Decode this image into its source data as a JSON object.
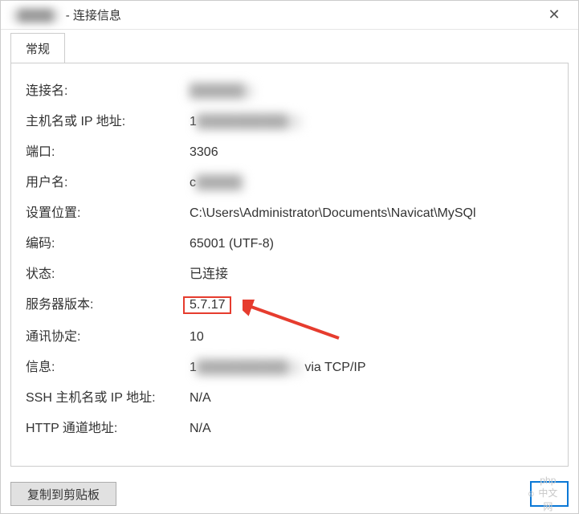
{
  "window": {
    "title_suffix": "- 连接信息",
    "close_glyph": "✕"
  },
  "tabs": {
    "general": "常规"
  },
  "fields": {
    "connection_name": {
      "label": "连接名:",
      "value": ""
    },
    "host": {
      "label": "主机名或 IP 地址:",
      "value": ""
    },
    "port": {
      "label": "端口:",
      "value": "3306"
    },
    "username": {
      "label": "用户名:",
      "value": ""
    },
    "settings_location": {
      "label": "设置位置:",
      "value": "C:\\Users\\Administrator\\Documents\\Navicat\\MySQl"
    },
    "encoding": {
      "label": "编码:",
      "value": "65001 (UTF-8)"
    },
    "status": {
      "label": "状态:",
      "value": "已连接"
    },
    "server_version": {
      "label": "服务器版本:",
      "value": "5.7.17"
    },
    "protocol": {
      "label": "通讯协定:",
      "value": "10"
    },
    "info": {
      "label": "信息:",
      "value_suffix": " via TCP/IP"
    },
    "ssh_host": {
      "label": "SSH 主机名或 IP 地址:",
      "value": "N/A"
    },
    "http_tunnel": {
      "label": "HTTP 通道地址:",
      "value": "N/A"
    }
  },
  "buttons": {
    "copy": "复制到剪贴板",
    "ok_watermark": "php中文网"
  }
}
